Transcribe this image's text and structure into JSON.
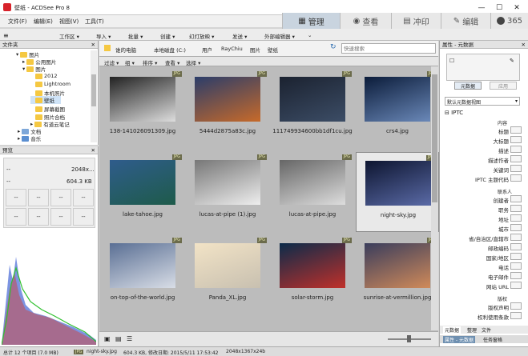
{
  "window": {
    "title": "壁纸 - ACDSee Pro 8",
    "controls": {
      "minimize": "—",
      "maximize": "☐",
      "close": "✕"
    }
  },
  "menu": [
    "文件(F)",
    "编辑(E)",
    "视图(V)",
    "工具(T)"
  ],
  "modes": [
    {
      "label": "管理",
      "icon": "manage-icon",
      "active": true
    },
    {
      "label": "查看",
      "icon": "eye-icon",
      "active": false
    },
    {
      "label": "冲印",
      "icon": "develop-icon",
      "active": false
    },
    {
      "label": "编辑",
      "icon": "edit-icon",
      "active": false
    },
    {
      "label": "365",
      "icon": "cloud-365-icon",
      "active": false
    }
  ],
  "toolbar": [
    "工作区 ▾",
    "导入 ▾",
    "批量 ▾",
    "创建 ▾",
    "幻灯放映 ▾",
    "发送 ▾",
    "外部编辑器 ▾"
  ],
  "folders": {
    "header": "文件夹",
    "items": [
      {
        "label": "图片",
        "level": 1,
        "expand": "▾"
      },
      {
        "label": "公用图片",
        "level": 2,
        "expand": "▸"
      },
      {
        "label": "图片",
        "level": 2,
        "expand": "▾"
      },
      {
        "label": "2012",
        "level": 3,
        "expand": ""
      },
      {
        "label": "Lightroom",
        "level": 3,
        "expand": ""
      },
      {
        "label": "本机照片",
        "level": 3,
        "expand": ""
      },
      {
        "label": "壁纸",
        "level": 3,
        "expand": "",
        "selected": true
      },
      {
        "label": "屏幕截图",
        "level": 3,
        "expand": ""
      },
      {
        "label": "照片合档",
        "level": 3,
        "expand": ""
      },
      {
        "label": "有道云笔记",
        "level": 3,
        "expand": "▸"
      },
      {
        "label": "文档",
        "level": 1,
        "expand": "▸"
      },
      {
        "label": "音乐",
        "level": 1,
        "expand": "▸"
      }
    ]
  },
  "preview": {
    "header": "预览",
    "dims": "2048x...",
    "size": "604.3 KB"
  },
  "address": {
    "path": [
      "谁的电脑",
      "本地磁盘 (C:)",
      "用户",
      "RayChiu",
      "图片",
      "壁纸"
    ],
    "search_placeholder": "快速搜索"
  },
  "filters": [
    "过滤 ▾",
    "组 ▾",
    "排序 ▾",
    "查看 ▾",
    "选择 ▾"
  ],
  "files": [
    {
      "name": "138-141026091309.jpg",
      "badge": "JPG",
      "colors": [
        "#222",
        "#ddd"
      ]
    },
    {
      "name": "5444d2875a83c.jpg",
      "badge": "JPG",
      "colors": [
        "#2b3d6a",
        "#c76a2a"
      ]
    },
    {
      "name": "111749934600bb1df1cu.jpg",
      "badge": "JPG",
      "colors": [
        "#1b2230",
        "#3c4d66"
      ]
    },
    {
      "name": "crs4.jpg",
      "badge": "JPG",
      "colors": [
        "#0b1c3a",
        "#6a88b8"
      ]
    },
    {
      "name": "lake-tahoe.jpg",
      "badge": "JPG",
      "colors": [
        "#2f5c8c",
        "#1e5b4a"
      ]
    },
    {
      "name": "lucas-at-pipe (1).jpg",
      "badge": "JPG",
      "colors": [
        "#777",
        "#eee"
      ]
    },
    {
      "name": "lucas-at-pipe.jpg",
      "badge": "JPG",
      "colors": [
        "#666",
        "#ddd"
      ]
    },
    {
      "name": "night-sky.jpg",
      "badge": "JPG",
      "colors": [
        "#0d1530",
        "#5a6aa6"
      ],
      "selected": true
    },
    {
      "name": "on-top-of-the-world.jpg",
      "badge": "JPG",
      "colors": [
        "#5a6f94",
        "#d8dde6"
      ]
    },
    {
      "name": "Panda_XL.jpg",
      "badge": "JPG",
      "colors": [
        "#f2e3c6",
        "#c8c0b0"
      ]
    },
    {
      "name": "solar-storm.jpg",
      "badge": "JPG",
      "colors": [
        "#0b2b4a",
        "#c0302a"
      ]
    },
    {
      "name": "sunrise-at-vermillion.jpg",
      "badge": "JPG",
      "colors": [
        "#3a3d5c",
        "#d08a5a"
      ]
    }
  ],
  "properties": {
    "header": "属性 - 元数据",
    "buttons": [
      "元数据",
      "应用"
    ],
    "view_select": "默认元数据视图",
    "section": "IPTC",
    "content_label": "内容",
    "contact_label": "联系人",
    "status_label": "版权",
    "fields": [
      "标题",
      "大标题",
      "描述",
      "描述作者",
      "关键词",
      "IPTC 主题代码"
    ],
    "contact_fields": [
      "创建者",
      "职务",
      "地址",
      "城市",
      "省/自治区/直辖市",
      "邮政编码",
      "国家/地区",
      "电话",
      "电子邮件",
      "网站 URL"
    ],
    "status_fields": [
      "版权声明",
      "权利使用条款"
    ],
    "tabs": [
      "元数据",
      "整理",
      "文件"
    ],
    "footer_tabs": [
      "属性 - 元数据",
      "任务窗格"
    ]
  },
  "status": {
    "total": "总计 12 个项目 (7.0 MB)",
    "badge": "JPG",
    "file": "night-sky.jpg",
    "size": "604.3 KB, 修改日期: 2015/5/11 17:53:42",
    "dims": "2048x1367x24b"
  },
  "colors": {
    "accent": "#2b6cb0",
    "selected_row": "#cfe3f7",
    "histogram_blue": "#3f6bd6",
    "histogram_red": "#d04040",
    "histogram_green": "#3fbf3f"
  }
}
